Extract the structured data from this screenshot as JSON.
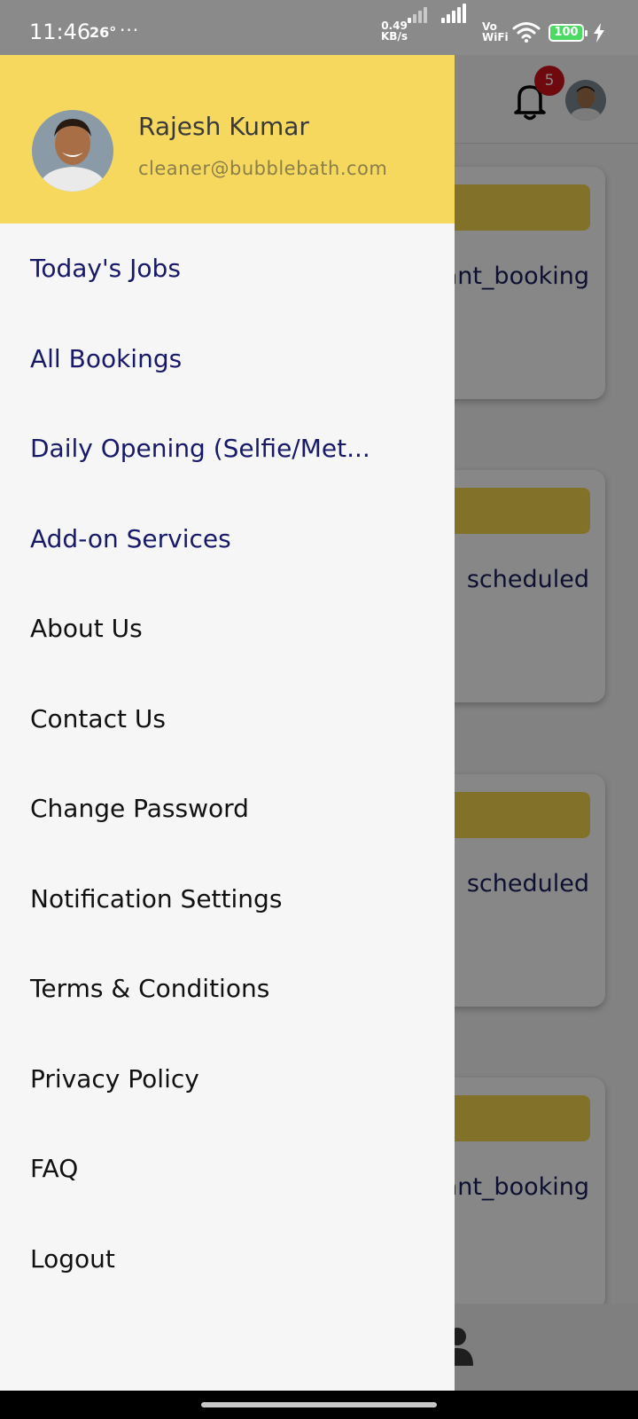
{
  "status_bar": {
    "time": "11:46",
    "temperature": "26°",
    "more": "···",
    "net_speed_value": "0.49",
    "net_speed_unit": "KB/s",
    "vowifi_top": "Vo",
    "vowifi_bottom": "WiFi",
    "battery": "100",
    "battery_color": "#4cd964"
  },
  "app": {
    "notification_count": "5",
    "cards": [
      {
        "status": "ant_booking"
      },
      {
        "status": "scheduled"
      },
      {
        "status": "scheduled"
      },
      {
        "status": "ant_booking"
      }
    ],
    "accent_color": "#f5d64f"
  },
  "drawer": {
    "user_name": "Rajesh Kumar",
    "user_email": "cleaner@bubblebath.com",
    "header_color": "#f6d85e",
    "menu_items": [
      {
        "label": "Today's Jobs"
      },
      {
        "label": "All Bookings"
      },
      {
        "label": "Daily Opening (Selfie/Met..."
      },
      {
        "label": "Add-on Services"
      },
      {
        "label": "About Us"
      },
      {
        "label": "Contact Us"
      },
      {
        "label": "Change Password"
      },
      {
        "label": "Notification Settings"
      },
      {
        "label": "Terms & Conditions"
      },
      {
        "label": "Privacy Policy"
      },
      {
        "label": "FAQ"
      },
      {
        "label": "Logout"
      }
    ]
  }
}
